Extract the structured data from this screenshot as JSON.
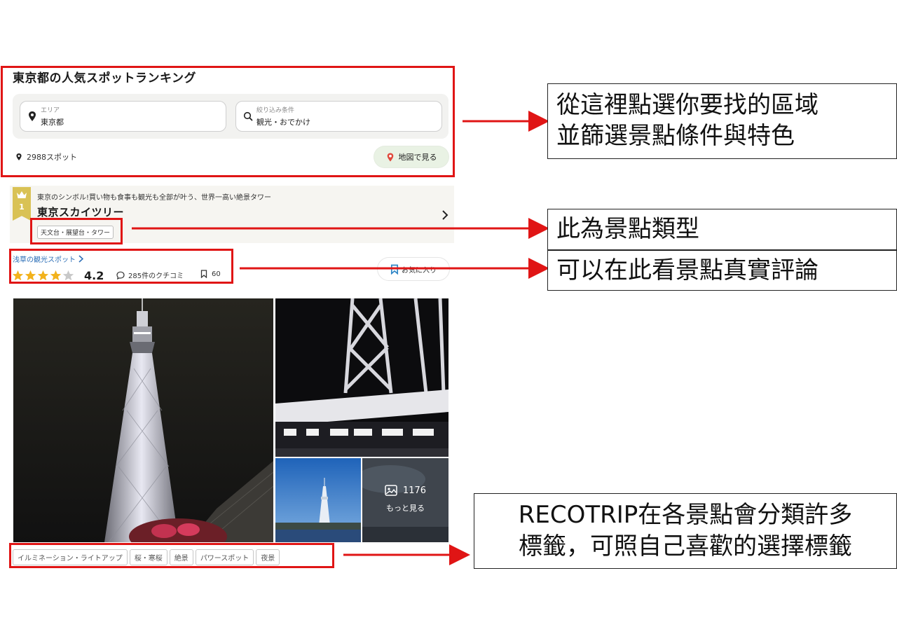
{
  "ranking": {
    "title": "東京都の人気スポットランキング",
    "area_field": {
      "label": "エリア",
      "value": "東京都"
    },
    "filter_field": {
      "label": "絞り込み条件",
      "value": "観光・おでかけ"
    },
    "spot_count": "2988スポット",
    "map_button": "地図で見る"
  },
  "spot": {
    "rank": "1",
    "description": "東京のシンボル!買い物も食事も観光も全部が叶う、世界一高い絶景タワー",
    "name": "東京スカイツリー",
    "category_tag": "天文台・展望台・タワー",
    "area_link": "浅草の観光スポット",
    "rating_value": "4.2",
    "rating_stars": 4,
    "review_count": "285件のクチコミ",
    "save_count": "60",
    "favorite_button": "お気に入り",
    "photo_count": "1176",
    "more_photos": "もっと見る",
    "feature_tags": [
      "イルミネーション・ライトアップ",
      "桜・寒桜",
      "絶景",
      "パワースポット",
      "夜景"
    ]
  },
  "annotations": {
    "box1": [
      "從這裡點選你要找的區域",
      "並篩選景點條件與特色"
    ],
    "box2": "此為景點類型",
    "box3": "可以在此看景點真實評論",
    "box4": [
      "RECOTRIP在各景點會分類許多",
      "標籤，可照自己喜歡的選擇標籤"
    ]
  },
  "colors": {
    "annotation_red": "#e01515",
    "star_gold": "#f2b21c",
    "link_blue": "#2d6fb7",
    "rank_gold": "#d9c255"
  }
}
